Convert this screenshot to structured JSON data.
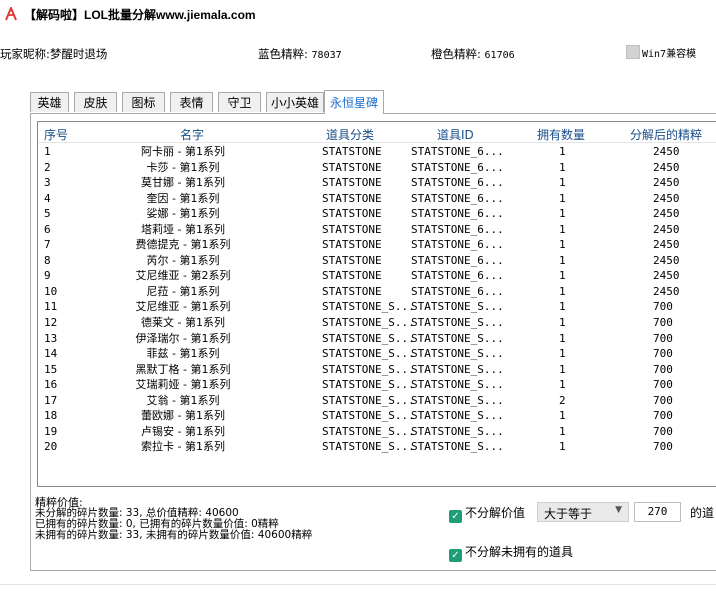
{
  "window": {
    "title": "【解码啦】LOL批量分解www.jiemala.com",
    "icon": "jiemala-logo-icon",
    "accent": "#e23a3a"
  },
  "player": {
    "name_label": "玩家昵称:",
    "name_value": "梦醒时退场"
  },
  "blue": {
    "label": "蓝色精粹:",
    "value": "78037"
  },
  "orange": {
    "label": "橙色精粹:",
    "value": "61706"
  },
  "compat": {
    "label": "Win7兼容模"
  },
  "tabs": [
    {
      "label": "英雄"
    },
    {
      "label": "皮肤"
    },
    {
      "label": "图标"
    },
    {
      "label": "表情"
    },
    {
      "label": "守卫"
    },
    {
      "label": "小小英雄"
    },
    {
      "label": "永恒星碑",
      "active": true
    }
  ],
  "table": {
    "columns": [
      "序号",
      "名字",
      "道具分类",
      "道具ID",
      "拥有数量",
      "分解后的精粹"
    ],
    "rows": [
      [
        "1",
        "阿卡丽 - 第1系列",
        "STATSTONE",
        "STATSTONE_6...",
        "1",
        "2450"
      ],
      [
        "2",
        "卡莎 - 第1系列",
        "STATSTONE",
        "STATSTONE_6...",
        "1",
        "2450"
      ],
      [
        "3",
        "莫甘娜 - 第1系列",
        "STATSTONE",
        "STATSTONE_6...",
        "1",
        "2450"
      ],
      [
        "4",
        "奎因 - 第1系列",
        "STATSTONE",
        "STATSTONE_6...",
        "1",
        "2450"
      ],
      [
        "5",
        "娑娜 - 第1系列",
        "STATSTONE",
        "STATSTONE_6...",
        "1",
        "2450"
      ],
      [
        "6",
        "塔莉垭 - 第1系列",
        "STATSTONE",
        "STATSTONE_6...",
        "1",
        "2450"
      ],
      [
        "7",
        "费德提克 - 第1系列",
        "STATSTONE",
        "STATSTONE_6...",
        "1",
        "2450"
      ],
      [
        "8",
        "芮尔 - 第1系列",
        "STATSTONE",
        "STATSTONE_6...",
        "1",
        "2450"
      ],
      [
        "9",
        "艾尼维亚 - 第2系列",
        "STATSTONE",
        "STATSTONE_6...",
        "1",
        "2450"
      ],
      [
        "10",
        "尼菈 - 第1系列",
        "STATSTONE",
        "STATSTONE_6...",
        "1",
        "2450"
      ],
      [
        "11",
        "艾尼维亚 - 第1系列",
        "STATSTONE_S...",
        "STATSTONE_S...",
        "1",
        "700"
      ],
      [
        "12",
        "德莱文 - 第1系列",
        "STATSTONE_S...",
        "STATSTONE_S...",
        "1",
        "700"
      ],
      [
        "13",
        "伊泽瑞尔 - 第1系列",
        "STATSTONE_S...",
        "STATSTONE_S...",
        "1",
        "700"
      ],
      [
        "14",
        "菲兹 - 第1系列",
        "STATSTONE_S...",
        "STATSTONE_S...",
        "1",
        "700"
      ],
      [
        "15",
        "黑默丁格 - 第1系列",
        "STATSTONE_S...",
        "STATSTONE_S...",
        "1",
        "700"
      ],
      [
        "16",
        "艾瑞莉娅 - 第1系列",
        "STATSTONE_S...",
        "STATSTONE_S...",
        "1",
        "700"
      ],
      [
        "17",
        "艾翁 - 第1系列",
        "STATSTONE_S...",
        "STATSTONE_S...",
        "2",
        "700"
      ],
      [
        "18",
        "蕾欧娜 - 第1系列",
        "STATSTONE_S...",
        "STATSTONE_S...",
        "1",
        "700"
      ],
      [
        "19",
        "卢锡安 - 第1系列",
        "STATSTONE_S...",
        "STATSTONE_S...",
        "1",
        "700"
      ],
      [
        "20",
        "索拉卡 - 第1系列",
        "STATSTONE_S...",
        "STATSTONE_S...",
        "1",
        "700"
      ]
    ]
  },
  "stats": {
    "label": "精粹价值:",
    "line1": "未分解的碎片数量: 33, 总价值精粹: 40600",
    "line2": "已拥有的碎片数量: 0, 已拥有的碎片数量价值: 0精粹",
    "line3": "未拥有的碎片数量: 33, 未拥有的碎片数量价值: 40600精粹"
  },
  "filters": {
    "no_decompose_value": "不分解价值",
    "comparator": "大于等于",
    "threshold": "270",
    "suffix": "的道",
    "no_decompose_unowned": "不分解未拥有的道具",
    "check_color": "#1e9e76"
  }
}
